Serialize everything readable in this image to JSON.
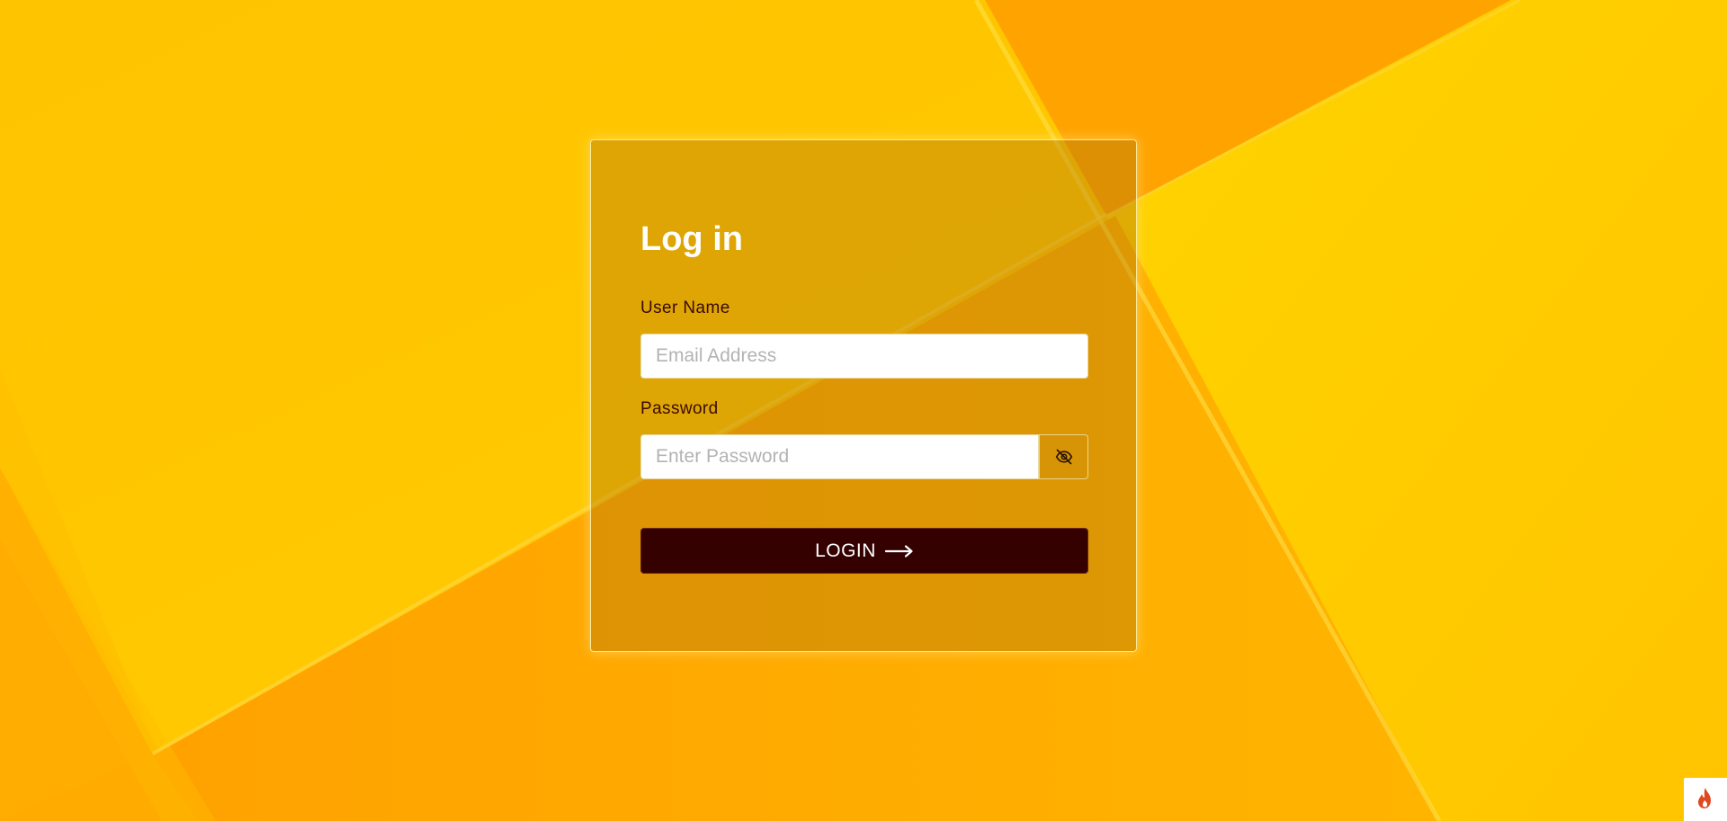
{
  "page": {
    "background_colors": [
      "#ffc400",
      "#ffa400",
      "#ffd600",
      "#ffb200"
    ]
  },
  "login": {
    "title": "Log in",
    "username": {
      "label": "User Name",
      "placeholder": "Email Address",
      "value": ""
    },
    "password": {
      "label": "Password",
      "placeholder": "Enter Password",
      "value": "",
      "toggle_icon": "eye-off-icon"
    },
    "submit": {
      "label": "LOGIN",
      "icon": "long-arrow-right-icon",
      "color": "#350000"
    }
  },
  "corner_badge": {
    "icon": "flame-icon",
    "color": "#e0481f"
  }
}
